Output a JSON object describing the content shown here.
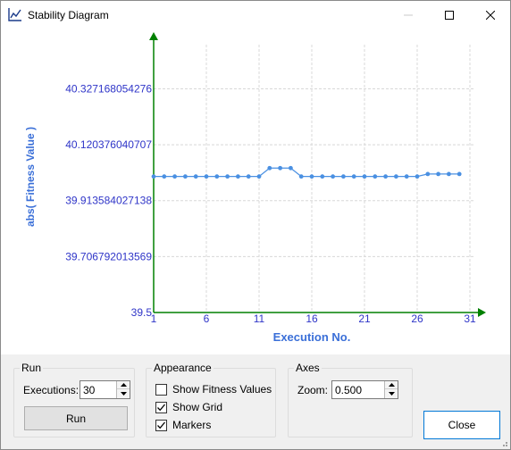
{
  "window": {
    "title": "Stability Diagram"
  },
  "chart_data": {
    "type": "line",
    "title": "",
    "xlabel": "Execution No.",
    "ylabel": "abs( Fitness Value )",
    "x_ticks": [
      "1",
      "6",
      "11",
      "16",
      "21",
      "26",
      "31"
    ],
    "x_tick_values": [
      1,
      6,
      11,
      16,
      21,
      26,
      31
    ],
    "y_ticks": [
      "39.5",
      "39.706792013569",
      "39.913584027138",
      "40.120376040707",
      "40.327168054276"
    ],
    "y_tick_values": [
      39.5,
      39.706792013569,
      39.913584027138,
      40.120376040707,
      40.327168054276
    ],
    "xlim": [
      1,
      31
    ],
    "ylim": [
      39.5,
      40.53
    ],
    "grid": true,
    "markers": true,
    "series": [
      {
        "color": "#4a90e2",
        "x": [
          1,
          2,
          3,
          4,
          5,
          6,
          7,
          8,
          9,
          10,
          11,
          12,
          13,
          14,
          15,
          16,
          17,
          18,
          19,
          20,
          21,
          22,
          23,
          24,
          25,
          26,
          27,
          28,
          29,
          30
        ],
        "values": [
          40.003,
          40.003,
          40.003,
          40.003,
          40.003,
          40.003,
          40.003,
          40.003,
          40.003,
          40.003,
          40.003,
          40.034,
          40.034,
          40.034,
          40.003,
          40.003,
          40.003,
          40.003,
          40.003,
          40.003,
          40.003,
          40.003,
          40.003,
          40.003,
          40.003,
          40.003,
          40.012,
          40.012,
          40.012,
          40.012
        ]
      }
    ],
    "axis_color": "#008000",
    "label_color": "#2f35c8",
    "title_label_color": "#3a6fd8"
  },
  "run_group": {
    "title": "Run",
    "executions_label": "Executions:",
    "executions_value": "30",
    "run_button": "Run"
  },
  "appearance_group": {
    "title": "Appearance",
    "show_fitness_label": "Show Fitness Values",
    "show_fitness_checked": false,
    "show_grid_label": "Show Grid",
    "show_grid_checked": true,
    "markers_label": "Markers",
    "markers_checked": true
  },
  "axes_group": {
    "title": "Axes",
    "zoom_label": "Zoom:",
    "zoom_value": "0.500"
  },
  "close_button": "Close"
}
